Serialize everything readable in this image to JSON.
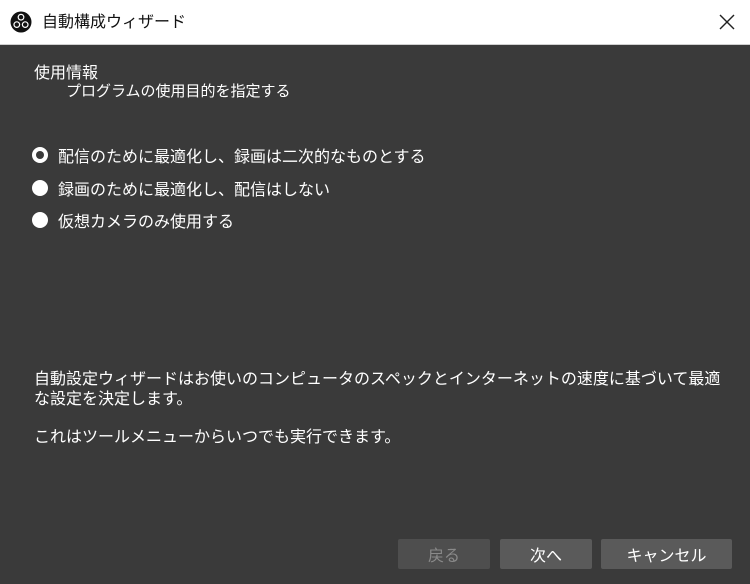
{
  "window": {
    "title": "自動構成ウィザード",
    "app_icon": "obs-logo-icon",
    "close_icon": "close-icon"
  },
  "section": {
    "title": "使用情報",
    "subtitle": "プログラムの使用目的を指定する"
  },
  "options": [
    {
      "label": "配信のために最適化し、録画は二次的なものとする",
      "selected": true
    },
    {
      "label": "録画のために最適化し、配信はしない",
      "selected": false
    },
    {
      "label": "仮想カメラのみ使用する",
      "selected": false
    }
  ],
  "info": {
    "line1": "自動設定ウィザードはお使いのコンピュータのスペックとインターネットの速度に基づいて最適な設定を決定します。",
    "line2": "これはツールメニューからいつでも実行できます。"
  },
  "buttons": {
    "back": "戻る",
    "next": "次へ",
    "cancel": "キャンセル"
  }
}
